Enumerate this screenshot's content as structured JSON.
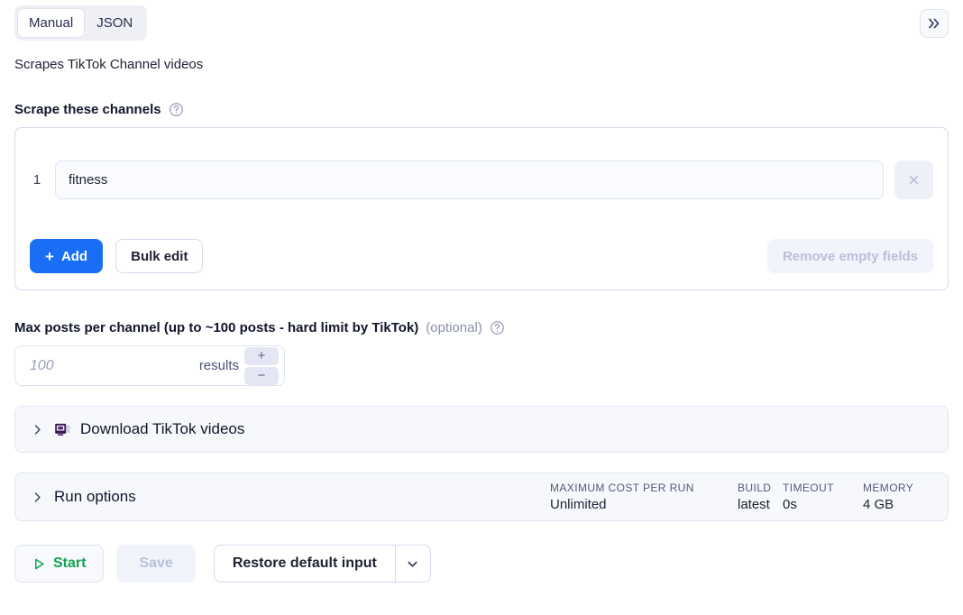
{
  "tabs": [
    {
      "label": "Manual",
      "active": true
    },
    {
      "label": "JSON",
      "active": false
    }
  ],
  "collapse_button": {
    "icon": "chevrons-right-icon"
  },
  "description": "Scrapes TikTok Channel videos",
  "channels_field": {
    "label": "Scrape these channels",
    "help_icon": "help-circle-icon",
    "rows": [
      {
        "index": "1",
        "value": "fitness",
        "remove_icon": "close-icon"
      }
    ],
    "add_label": "Add",
    "add_plus": "+",
    "bulk_edit_label": "Bulk edit",
    "remove_empty_label": "Remove empty fields"
  },
  "max_posts_field": {
    "label": "Max posts per channel (up to ~100 posts - hard limit by TikTok)",
    "optional": "(optional)",
    "help_icon": "help-circle-icon",
    "value": "",
    "placeholder": "100",
    "suffix": "results",
    "increment_label": "+",
    "decrement_label": "−"
  },
  "sections": [
    {
      "title": "Download TikTok videos",
      "chevron_icon": "chevron-right-icon",
      "icon": "video-collection-icon"
    }
  ],
  "run_options": {
    "title": "Run options",
    "chevron_icon": "chevron-right-icon",
    "stats": [
      {
        "label": "MAXIMUM COST PER RUN",
        "value": "Unlimited"
      },
      {
        "label": "BUILD",
        "value": "latest"
      },
      {
        "label": "TIMEOUT",
        "value": "0s"
      },
      {
        "label": "MEMORY",
        "value": "4 GB"
      }
    ]
  },
  "toolbar": {
    "start_label": "Start",
    "start_icon": "play-icon",
    "save_label": "Save",
    "restore_label": "Restore default input",
    "caret_icon": "chevron-down-icon"
  },
  "colors": {
    "primary": "#1a6ef5",
    "start_green": "#13a452",
    "panel_bg": "#f7f8fc",
    "border": "#d6daed",
    "muted_text": "#8a91ad"
  }
}
